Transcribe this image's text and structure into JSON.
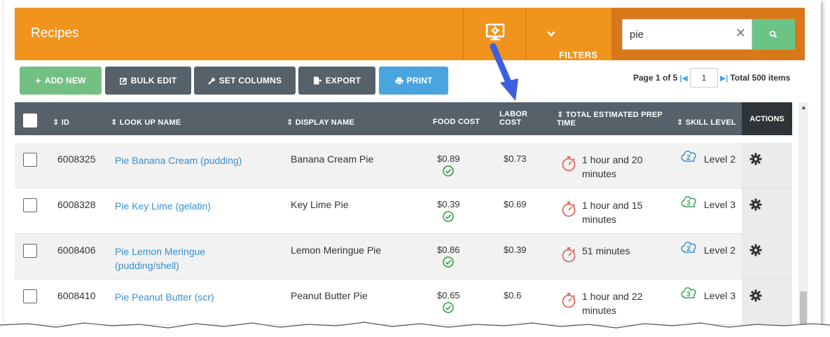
{
  "header": {
    "title": "Recipes",
    "filters_label": "FILTERS",
    "search_value": "pie",
    "clear_symbol": "✕"
  },
  "toolbar": {
    "add_new": "ADD NEW",
    "bulk_edit": "BULK EDIT",
    "set_columns": "SET COLUMNS",
    "export": "EXPORT",
    "print": "PRINT"
  },
  "pager": {
    "page_text": "Page 1 of 5",
    "current_page": "1",
    "total_text": "Total 500 items"
  },
  "table": {
    "headers": {
      "id": "ID",
      "lookup_name": "LOOK UP NAME",
      "display_name": "DISPLAY NAME",
      "food_cost": "FOOD COST",
      "labor_cost_1": "LABOR",
      "labor_cost_2": "COST",
      "prep_time_1": "TOTAL ESTIMATED PREP",
      "prep_time_2": "TIME",
      "skill_level": "SKILL LEVEL",
      "actions": "ACTIONS"
    },
    "rows": [
      {
        "id": "6008325",
        "lookup_1": "Pie Banana Cream (pudding)",
        "lookup_2": "",
        "display": "Banana Cream Pie",
        "food_cost": "$0.89",
        "labor_cost": "$0.73",
        "prep_1": "1 hour and 20",
        "prep_2": "minutes",
        "skill": "Level 2",
        "skill_num": "2"
      },
      {
        "id": "6008328",
        "lookup_1": "Pie Key Lime (gelatin)",
        "lookup_2": "",
        "display": "Key Lime Pie",
        "food_cost": "$0.39",
        "labor_cost": "$0.69",
        "prep_1": "1 hour and 15",
        "prep_2": "minutes",
        "skill": "Level 3",
        "skill_num": "3"
      },
      {
        "id": "6008406",
        "lookup_1": "Pie Lemon Meringue",
        "lookup_2": "(pudding/shell)",
        "display": "Lemon Meringue Pie",
        "food_cost": "$0.86",
        "labor_cost": "$0.39",
        "prep_1": "51 minutes",
        "prep_2": "",
        "skill": "Level 2",
        "skill_num": "2"
      },
      {
        "id": "6008410",
        "lookup_1": "Pie Peanut Butter (scr)",
        "lookup_2": "",
        "display": "Peanut Butter Pie",
        "food_cost": "$0.65",
        "labor_cost": "$0.6",
        "prep_1": "1 hour and 22",
        "prep_2": "minutes",
        "skill": "Level 3",
        "skill_num": "3"
      }
    ]
  },
  "colors": {
    "header_orange": "#f0941e",
    "search_bg": "#d8781a",
    "green": "#72c183",
    "dark": "#56616a",
    "blue": "#4aa4dd",
    "link": "#3a8fcc",
    "arrow": "#3b5fe0"
  }
}
